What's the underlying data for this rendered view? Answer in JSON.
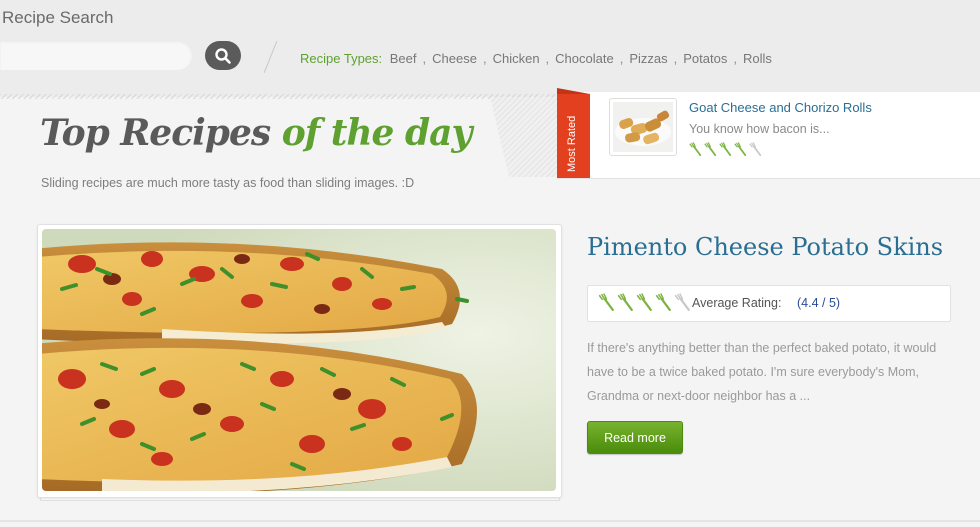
{
  "search": {
    "title": "Recipe Search",
    "placeholder": "",
    "button_icon": "magnifier-icon"
  },
  "recipe_types": {
    "label": "Recipe Types:",
    "items": [
      "Beef",
      "Cheese",
      "Chicken",
      "Chocolate",
      "Pizzas",
      "Potatos",
      "Rolls"
    ],
    "separator": ","
  },
  "header": {
    "logo_part1": "Top Recipes",
    "logo_part2": "of the day",
    "tagline": "Sliding recipes are much more tasty as food than sliding images. :D"
  },
  "most_rated": {
    "ribbon": "Most Rated",
    "title": "Goat Cheese and Chorizo Rolls",
    "excerpt": "You know how bacon is...",
    "rating_forks": 4,
    "rating_max": 5
  },
  "featured": {
    "title": "Pimento Cheese Potato Skins",
    "rating_label": "Average Rating:",
    "rating_value": "(4.4 / 5)",
    "rating_forks": 4,
    "rating_max": 5,
    "description": "If there's anything better than the perfect baked potato, it would have to be a twice baked potato. I'm sure everybody's Mom, Grandma or next-door neighbor has a ...",
    "read_more_label": "Read more"
  },
  "colors": {
    "accent_green": "#5ea130",
    "link_blue": "#2a6e93",
    "ribbon_red": "#e2401e",
    "fork_on": "#7cb342",
    "fork_off": "#c8c8c8"
  }
}
